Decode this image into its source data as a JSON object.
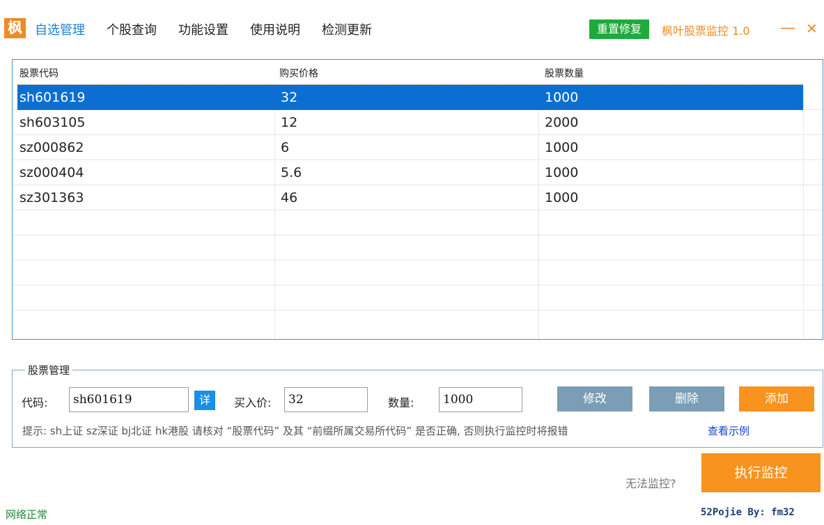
{
  "app": {
    "logo_char": "枫",
    "title": "枫叶股票监控 1.0",
    "reset_label": "重置修复",
    "minimize_glyph": "—",
    "close_glyph": "✕"
  },
  "menu": {
    "items": [
      {
        "label": "自选管理",
        "active": true
      },
      {
        "label": "个股查询",
        "active": false
      },
      {
        "label": "功能设置",
        "active": false
      },
      {
        "label": "使用说明",
        "active": false
      },
      {
        "label": "检测更新",
        "active": false
      }
    ]
  },
  "table": {
    "columns": [
      "股票代码",
      "购买价格",
      "股票数量"
    ],
    "rows": [
      {
        "code": "sh601619",
        "price": "32",
        "qty": "1000",
        "selected": true
      },
      {
        "code": "sh603105",
        "price": "12",
        "qty": "2000",
        "selected": false
      },
      {
        "code": "sz000862",
        "price": "6",
        "qty": "1000",
        "selected": false
      },
      {
        "code": "sz000404",
        "price": "5.6",
        "qty": "1000",
        "selected": false
      },
      {
        "code": "sz301363",
        "price": "46",
        "qty": "1000",
        "selected": false
      }
    ]
  },
  "manage": {
    "legend": "股票管理",
    "code_label": "代码:",
    "code_value": "sh601619",
    "detail_label": "详",
    "price_label": "买入价:",
    "price_value": "32",
    "qty_label": "数量:",
    "qty_value": "1000",
    "edit_label": "修改",
    "delete_label": "删除",
    "add_label": "添加",
    "hint": "提示: sh上证 sz深证 bj北证 hk港股  请核对 “股票代码” 及其 “前缀所属交易所代码” 是否正确, 否则执行监控时将报错",
    "hint_link": "查看示例"
  },
  "footer": {
    "cant_monitor": "无法监控?",
    "run_label": "执行监控",
    "network_status": "网络正常",
    "credit": "52Pojie By: fm32"
  },
  "colors": {
    "accent_blue": "#1e7fd4",
    "selection": "#0a6fd0",
    "orange": "#f7931e",
    "green": "#1faa3a",
    "muted_button": "#7b9db6"
  }
}
